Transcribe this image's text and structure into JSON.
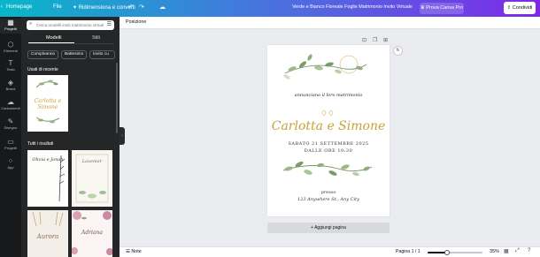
{
  "topbar": {
    "home": "Homepage",
    "file": "File",
    "resize": "Ridimensiona e converti",
    "doc_title": "Verde e Bianco Floreale Foglie Matrimonio Invito Virtuale",
    "pro": "Prova Canva Pro",
    "share": "Condividi"
  },
  "rail": [
    {
      "icon": "grid-icon",
      "glyph": "▦",
      "label": "Progetti"
    },
    {
      "icon": "shapes-icon",
      "glyph": "⬡",
      "label": "Elementi"
    },
    {
      "icon": "text-icon",
      "glyph": "T",
      "label": "Testo"
    },
    {
      "icon": "brand-icon",
      "glyph": "◈",
      "label": "Brand"
    },
    {
      "icon": "upload-icon",
      "glyph": "☁",
      "label": "Caricamenti"
    },
    {
      "icon": "draw-icon",
      "glyph": "✎",
      "label": "Disegno"
    },
    {
      "icon": "folder-icon",
      "glyph": "▭",
      "label": "Progetti"
    },
    {
      "icon": "apps-icon",
      "glyph": "⁘",
      "label": "App"
    }
  ],
  "panel": {
    "search_placeholder": "Cerca modelli inviti matrimonio virtuale",
    "tabs": [
      "Modelli",
      "Stili"
    ],
    "chips": [
      "Compleanno",
      "Battesimo",
      "Invito cu"
    ],
    "recent_title": "Usati di recente",
    "all_title": "Tutti i risultati",
    "recent_thumb": {
      "names": "Carlotta e Simone"
    },
    "results": [
      {
        "title": "Olivia e Jonah"
      },
      {
        "title": "Lavenier"
      },
      {
        "title": "Aurora"
      },
      {
        "title": "Adriana"
      }
    ]
  },
  "toolbar": {
    "position": "Posizione"
  },
  "invite": {
    "subtitle": "annunciano il loro matrimonio",
    "names": "Carlotta e Simone",
    "date": "SABATO 21 SETTEMBRE 2025",
    "time": "DALLE ORE 10:30",
    "place": "presso",
    "address": "123 Anywhere St., Any City"
  },
  "canvas": {
    "add_page": "+ Aggiungi pagina"
  },
  "bottombar": {
    "notes": "Note",
    "page": "Pagina 1 / 1",
    "zoom": "35%",
    "zoom_level": 0.35
  },
  "colors": {
    "accent": "#7d2ae8",
    "gold": "#c9a13a",
    "panel": "#252627"
  }
}
